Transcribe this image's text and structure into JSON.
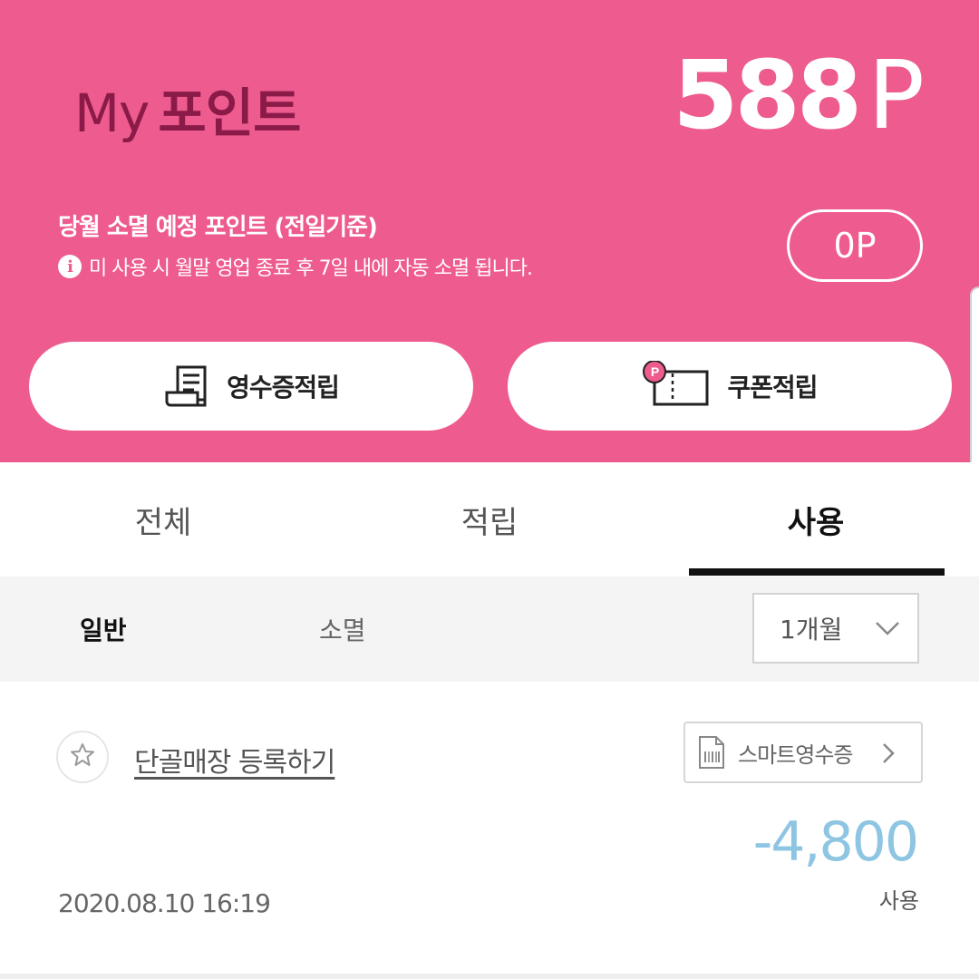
{
  "header": {
    "title_light": "My",
    "title_bold": "포인트",
    "total_points_value": "588",
    "total_points_unit": "P",
    "expire_title": "당월 소멸 예정 포인트 (전일기준)",
    "expire_note": "미 사용 시 월말 영업 종료 후 7일 내에 자동 소멸 됩니다.",
    "info_icon_glyph": "i",
    "expire_points": "0P",
    "receipt_button_label": "영수증적립",
    "coupon_button_label": "쿠폰적립",
    "coupon_badge": "P"
  },
  "tabs": [
    {
      "label": "전체"
    },
    {
      "label": "적립"
    },
    {
      "label": "사용"
    }
  ],
  "active_tab": "사용",
  "filters": {
    "general_label": "일반",
    "expired_label": "소멸",
    "period_selected": "1개월"
  },
  "records": [
    {
      "store_link": "단골매장 등록하기",
      "smart_receipt_label": "스마트영수증",
      "amount": "-4,800",
      "type": "사용",
      "datetime": "2020.08.10 16:19"
    }
  ],
  "colors": {
    "brand_pink": "#ee5b8e",
    "title_dark": "#8a1a48",
    "amount_blue": "#8ec5e2"
  },
  "icons": [
    "info-icon",
    "receipt-icon",
    "coupon-icon",
    "chevron-down-icon",
    "star-icon",
    "smart-receipt-icon",
    "chevron-right-icon"
  ]
}
